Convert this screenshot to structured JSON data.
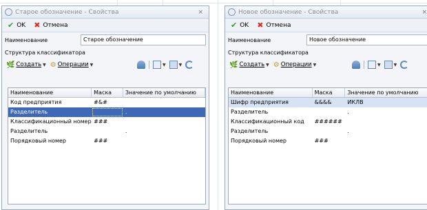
{
  "dialogs": [
    {
      "title": "Старое обозначение - Свойства",
      "close_glyph": "×",
      "ok_label": "OK",
      "cancel_label": "Отмена",
      "name_label": "Наименование",
      "name_value": "Старое обозначение",
      "structure_label": "Структура классификатора",
      "create_label": "Создать",
      "operations_label": "Операции",
      "columns": [
        "Наименование",
        "Маска",
        "Значение по умолчанию"
      ],
      "rows": [
        {
          "name": "Код предприятия",
          "mask": "#&#",
          "default": ""
        },
        {
          "name": "Разделитель",
          "mask": "",
          "default": "."
        },
        {
          "name": "Классификационный номер",
          "mask": "###",
          "default": ""
        },
        {
          "name": "Разделитель",
          "mask": "",
          "default": "."
        },
        {
          "name": "Порядковый номер",
          "mask": "###",
          "default": ""
        }
      ],
      "selected_row": 1
    },
    {
      "title": "Новое обозначение - Свойства",
      "close_glyph": "×",
      "ok_label": "OK",
      "cancel_label": "Отмена",
      "name_label": "Наименование",
      "name_value": "Новое обозначение",
      "structure_label": "Структура классификатора",
      "create_label": "Создать",
      "operations_label": "Операции",
      "columns": [
        "Наименование",
        "Маска",
        "Значение по умолчанию"
      ],
      "rows": [
        {
          "name": "Шифр предприятия",
          "mask": "&&&&",
          "default": "ИКЛВ"
        },
        {
          "name": "Разделитель",
          "mask": "",
          "default": "."
        },
        {
          "name": "Классификационный код",
          "mask": "######",
          "default": ""
        },
        {
          "name": "Разделитель",
          "mask": "",
          "default": "."
        },
        {
          "name": "Порядковый номер",
          "mask": "###",
          "default": ""
        }
      ],
      "selected_row": 0
    }
  ],
  "icons": {
    "ok": "check-icon",
    "cancel": "cross-icon",
    "create": "leaf-icon",
    "operations": "gear-icon"
  },
  "colors": {
    "selection_strong": "#3d69b7",
    "selection_soft": "#d6e3f5",
    "ok_green": "#3f9a2f",
    "cancel_red": "#d6341e"
  }
}
